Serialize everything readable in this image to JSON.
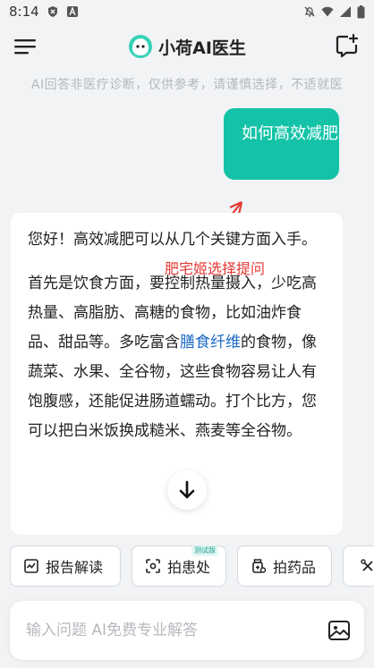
{
  "status_bar": {
    "time": "8:14"
  },
  "header": {
    "title": "小荷AI医生"
  },
  "disclaimer": "AI回答非医疗诊断，仅供参考，请谨慎选择，不适就医",
  "conversation": {
    "user_message": "如何高效减肥",
    "annotation": "肥宅姬选择提问",
    "assistant": {
      "para1": "您好！高效减肥可以从几个关键方面入手。",
      "para2_before": "首先是饮食方面，要控制热量摄入，少吃高热量、高脂肪、高糖的食物，比如油炸食品、甜品等。多吃富含",
      "para2_link": "膳食纤维",
      "para2_after": "的食物，像蔬菜、水果、全谷物，这些食物容易让人有饱腹感，还能促进肠道蠕动。打个比方，您可以把白米饭换成糙米、燕麦等全谷物。"
    }
  },
  "quick_actions": [
    {
      "label": "报告解读",
      "icon": "report-icon"
    },
    {
      "label": "拍患处",
      "icon": "scan-icon",
      "badge": "测试版"
    },
    {
      "label": "拍药品",
      "icon": "medicine-icon"
    },
    {
      "label": "",
      "icon": "more-tool-icon"
    }
  ],
  "input": {
    "placeholder": "输入问题 AI免费专业解答"
  },
  "colors": {
    "accent": "#14c3a7",
    "link": "#1e6bc4",
    "annotation": "#e53935"
  }
}
